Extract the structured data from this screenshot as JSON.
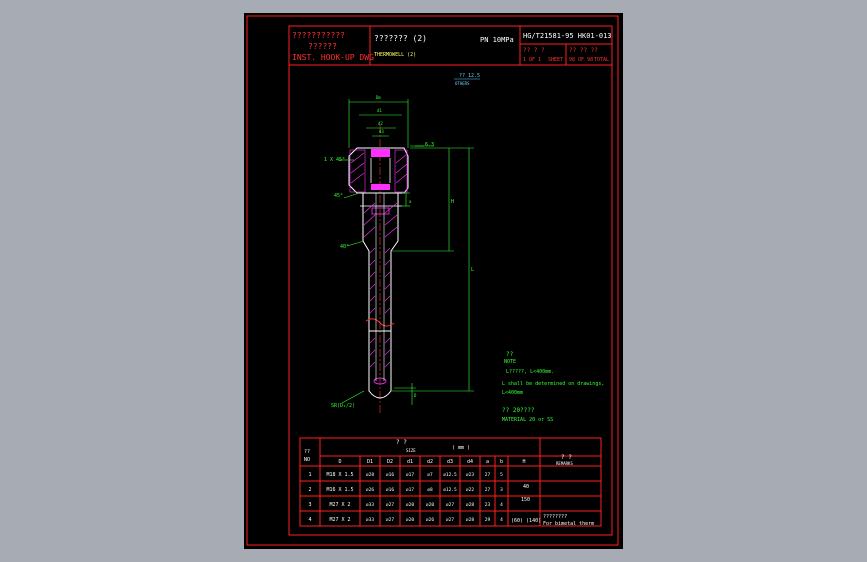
{
  "title_block": {
    "cn_title_1": "???????????",
    "cn_title_2": "??????",
    "en_title": "INST. HOOK-UP DWG",
    "item_cn": "???????  (2)",
    "item_en": "THERMOWELL (2)",
    "pressure": "PN 10MPa",
    "standard": "HG/T21581-95  HK01-013",
    "sheet_label_cn": "?? ? ?",
    "sheet_no": "1  OF  1",
    "sheet_en": "SHEET",
    "total_cn": "?? ?? ??",
    "total_no": "98 OF 98",
    "total_en": "TOTAL"
  },
  "drawing": {
    "roughness_cn": "?? 12.5",
    "roughness_en": "OTHERS",
    "dim_top_1": "Dm",
    "dim_top_2": "d1",
    "dim_top_3": "d2",
    "dim_top_4": "d3",
    "chamfer": "1 X 45°",
    "angle_45": "45°",
    "angle_40": "40°",
    "dim_s": "6.3",
    "dim_h": "H",
    "dim_l": "L",
    "dim_b": "a",
    "dim_d": "D",
    "dim_sr": "SR(D₂/2)"
  },
  "notes": {
    "head_cn": "??",
    "head_en": "NOTE",
    "line1": "L?????,  L<400mm.",
    "line2": "L shall be determined on drawings,",
    "line3": "L<400mm",
    "mat_cn": "??  20????",
    "mat_en": "MATERIAL  20 or SS"
  },
  "table": {
    "title_cn": "?       ?",
    "title_en": "SIZE",
    "unit": "( mm )",
    "no_cn": "??",
    "no_en": "NO",
    "remarks_cn": "?    ?",
    "remarks_en": "REMARKS",
    "headers": [
      "D",
      "D1",
      "D2",
      "d1",
      "d2",
      "d3",
      "d4",
      "a",
      "b",
      "H"
    ],
    "rows": [
      {
        "no": "1",
        "cells": [
          "M18 X 1.5",
          "⌀28",
          "⌀16",
          "⌀17",
          "⌀7",
          "⌀12.5",
          "⌀23",
          "27",
          "5"
        ]
      },
      {
        "no": "2",
        "cells": [
          "M16 X 1.5",
          "⌀26",
          "⌀16",
          "⌀17",
          "⌀8",
          "⌀12.5",
          "⌀22",
          "27",
          "3"
        ]
      },
      {
        "no": "3",
        "cells": [
          "M27 X 2",
          "⌀33",
          "⌀27",
          "⌀20",
          "⌀20",
          "⌀27",
          "⌀28",
          "23",
          "4"
        ]
      },
      {
        "no": "4",
        "cells": [
          "M27 X 2",
          "⌀33",
          "⌀27",
          "⌀20",
          "⌀26",
          "⌀27",
          "⌀28",
          "29",
          "4"
        ]
      }
    ],
    "h_values": [
      "40",
      "150"
    ],
    "h_last": "(60) (140)",
    "remark_last_cn": "????????",
    "remark_last_en": "For bimetal therm"
  }
}
